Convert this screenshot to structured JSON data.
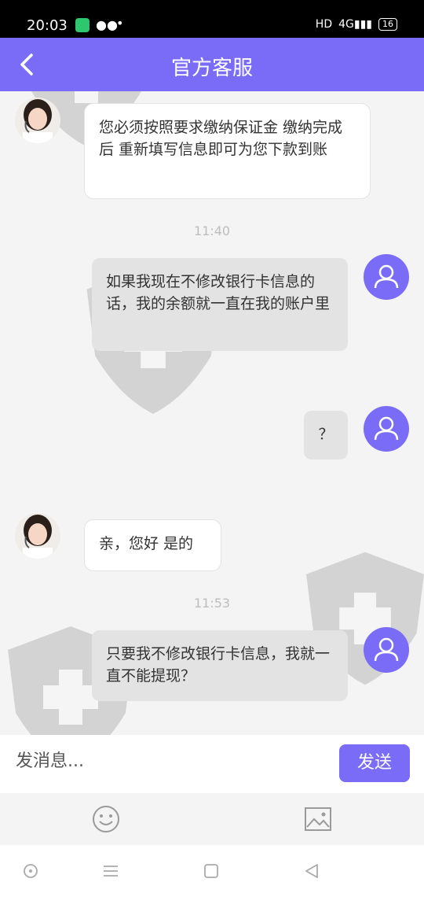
{
  "status_bar": {
    "time": "20:03",
    "network": "HD",
    "signal": "4G",
    "battery": "16"
  },
  "header": {
    "title": "官方客服"
  },
  "messages": [
    {
      "text": "您必须按照要求缴纳保证金 缴纳完成后 重新填写信息即可为您下款到账"
    },
    {
      "timestamp": "11:40"
    },
    {
      "text": "如果我现在不修改银行卡信息的话，我的余额就一直在我的账户里"
    },
    {
      "text": "？"
    },
    {
      "text": "亲，您好 是的"
    },
    {
      "timestamp": "11:53"
    },
    {
      "text": "只要我不修改银行卡信息，我就一直不能提现？"
    }
  ],
  "input": {
    "placeholder": "发消息...",
    "send_label": "发送"
  },
  "colors": {
    "accent": "#7a6cf6",
    "bubble_out": "#e3e3e3",
    "bubble_in": "#ffffff"
  },
  "icons": [
    "back-arrow-icon",
    "emoji-icon",
    "image-icon",
    "nav-circle-icon",
    "nav-menu-icon",
    "nav-home-icon",
    "nav-back-icon"
  ]
}
